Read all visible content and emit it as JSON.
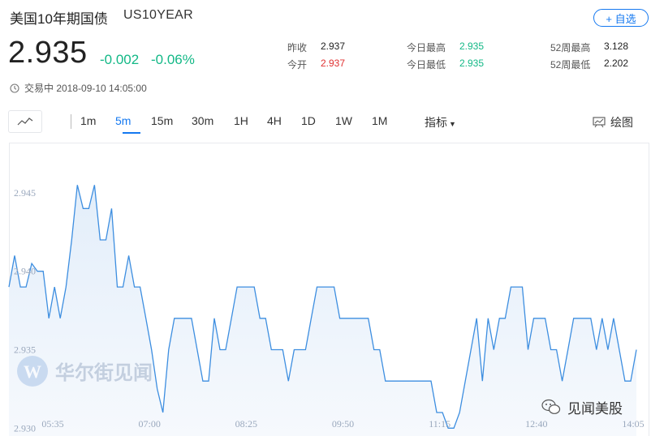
{
  "header": {
    "name": "美国10年期国债",
    "code": "US10YEAR",
    "fav_label": "+ 自选"
  },
  "quote": {
    "price": "2.935",
    "change": "-0.002",
    "change_pct": "-0.06%",
    "status": "交易中 2018-09-10 14:05:00"
  },
  "stats": {
    "prev_close_label": "昨收",
    "prev_close": "2.937",
    "open_label": "今开",
    "open": "2.937",
    "day_high_label": "今日最高",
    "day_high": "2.935",
    "day_low_label": "今日最低",
    "day_low": "2.935",
    "wk52_high_label": "52周最高",
    "wk52_high": "3.128",
    "wk52_low_label": "52周最低",
    "wk52_low": "2.202"
  },
  "toolbar": {
    "periods": [
      "1m",
      "5m",
      "15m",
      "30m",
      "1H",
      "4H",
      "1D",
      "1W",
      "1M"
    ],
    "active_period": "5m",
    "indicator_label": "指标",
    "draw_label": "绘图"
  },
  "watermark": {
    "main": "华尔街见闻",
    "corner": "见闻美股"
  },
  "colors": {
    "accent": "#1478f0",
    "up_green": "#12b886",
    "down_red": "#e03131",
    "line": "#3d8ee0",
    "fill": "#eef5fc"
  },
  "chart_data": {
    "type": "area",
    "xlabels": [
      "05:35",
      "07:00",
      "08:25",
      "09:50",
      "11:15",
      "12:40",
      "14:05"
    ],
    "ylabels": [
      "2.945",
      "2.940",
      "2.935",
      "2.930"
    ],
    "ylim": [
      2.9295,
      2.9482
    ],
    "grid": false,
    "values": [
      2.939,
      2.941,
      2.939,
      2.939,
      2.9405,
      2.94,
      2.94,
      2.937,
      2.939,
      2.937,
      2.939,
      2.942,
      2.9455,
      2.944,
      2.944,
      2.9455,
      2.942,
      2.942,
      2.944,
      2.939,
      2.939,
      2.941,
      2.939,
      2.939,
      2.937,
      2.935,
      2.9325,
      2.931,
      2.935,
      2.937,
      2.937,
      2.937,
      2.937,
      2.935,
      2.933,
      2.933,
      2.937,
      2.935,
      2.935,
      2.937,
      2.939,
      2.939,
      2.939,
      2.939,
      2.937,
      2.937,
      2.935,
      2.935,
      2.935,
      2.933,
      2.935,
      2.935,
      2.935,
      2.937,
      2.939,
      2.939,
      2.939,
      2.939,
      2.937,
      2.937,
      2.937,
      2.937,
      2.937,
      2.937,
      2.935,
      2.935,
      2.933,
      2.933,
      2.933,
      2.933,
      2.933,
      2.933,
      2.933,
      2.933,
      2.933,
      2.931,
      2.931,
      2.93,
      2.93,
      2.931,
      2.933,
      2.935,
      2.937,
      2.933,
      2.937,
      2.935,
      2.937,
      2.937,
      2.939,
      2.939,
      2.939,
      2.935,
      2.937,
      2.937,
      2.937,
      2.935,
      2.935,
      2.933,
      2.935,
      2.937,
      2.937,
      2.937,
      2.937,
      2.935,
      2.937,
      2.935,
      2.937,
      2.935,
      2.933,
      2.933,
      2.935
    ]
  }
}
